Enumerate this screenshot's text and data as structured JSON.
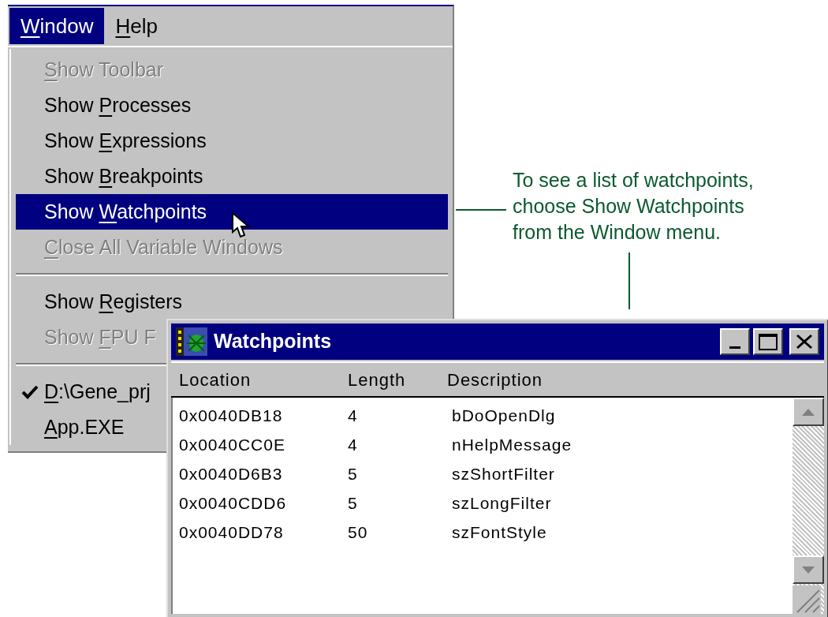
{
  "menu_bar": {
    "items": [
      {
        "key": "W",
        "post": "indow",
        "selected": true
      },
      {
        "key": "H",
        "post": "elp",
        "selected": false
      }
    ]
  },
  "menu": {
    "items": [
      {
        "kind": "item",
        "key": "S",
        "post": "how Toolbar",
        "disabled": true,
        "selected": false,
        "checked": false
      },
      {
        "kind": "item",
        "pre": "Show ",
        "key": "P",
        "post": "rocesses",
        "disabled": false,
        "selected": false,
        "checked": false
      },
      {
        "kind": "item",
        "pre": "Show ",
        "key": "E",
        "post": "xpressions",
        "disabled": false,
        "selected": false,
        "checked": false
      },
      {
        "kind": "item",
        "pre": "Show ",
        "key": "B",
        "post": "reakpoints",
        "disabled": false,
        "selected": false,
        "checked": false
      },
      {
        "kind": "item",
        "pre": "Show ",
        "key": "W",
        "post": "atchpoints",
        "disabled": false,
        "selected": true,
        "checked": false
      },
      {
        "kind": "item",
        "key": "C",
        "post": "lose All Variable Windows",
        "disabled": true,
        "selected": false,
        "checked": false
      },
      {
        "kind": "separator"
      },
      {
        "kind": "item",
        "pre": "Show ",
        "key": "R",
        "post": "egisters",
        "disabled": false,
        "selected": false,
        "checked": false
      },
      {
        "kind": "item",
        "pre": "Show ",
        "key": "F",
        "post": "PU F",
        "disabled": true,
        "selected": false,
        "checked": false
      },
      {
        "kind": "separator"
      },
      {
        "kind": "item",
        "key": "D",
        "post": ":\\Gene_prj",
        "disabled": false,
        "selected": false,
        "checked": true
      },
      {
        "kind": "item",
        "key": "A",
        "post": "pp.EXE",
        "disabled": false,
        "selected": false,
        "checked": false
      }
    ]
  },
  "callout": {
    "lines": [
      "To see a list of watchpoints,",
      "choose Show Watchpoints",
      "from the Window menu."
    ]
  },
  "watch_window": {
    "title": "Watchpoints",
    "columns": [
      "Location",
      "Length",
      "Description"
    ],
    "rows": [
      [
        "0x0040DB18",
        "4",
        "bDoOpenDlg"
      ],
      [
        "0x0040CC0E",
        "4",
        "nHelpMessage"
      ],
      [
        "0x0040D6B3",
        "5",
        "szShortFilter"
      ],
      [
        "0x0040CDD6",
        "5",
        "szLongFilter"
      ],
      [
        "0x0040DD78",
        "50",
        "szFontStyle"
      ]
    ]
  }
}
